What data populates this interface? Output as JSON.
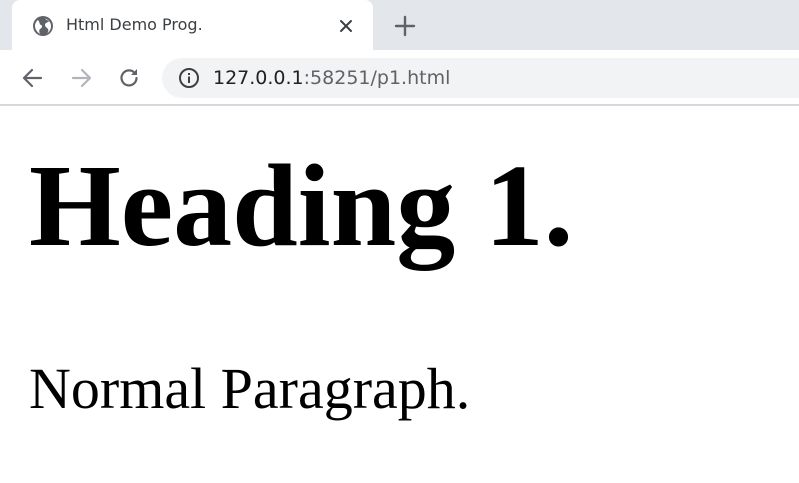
{
  "tab": {
    "title": "Html Demo Prog.",
    "icon": "globe-icon",
    "close_icon": "close-icon"
  },
  "new_tab": {
    "icon": "plus-icon"
  },
  "toolbar": {
    "back_icon": "back-arrow-icon",
    "forward_icon": "forward-arrow-icon",
    "reload_icon": "reload-icon"
  },
  "address_bar": {
    "info_icon": "info-icon",
    "url_host": "127.0.0.1",
    "url_rest": ":58251/p1.html"
  },
  "page": {
    "heading": "Heading 1.",
    "paragraph": "Normal Paragraph."
  },
  "colors": {
    "tabstrip_bg": "#e3e6ea",
    "omnibox_bg": "#f1f3f4",
    "icon_color": "#5f6368"
  }
}
